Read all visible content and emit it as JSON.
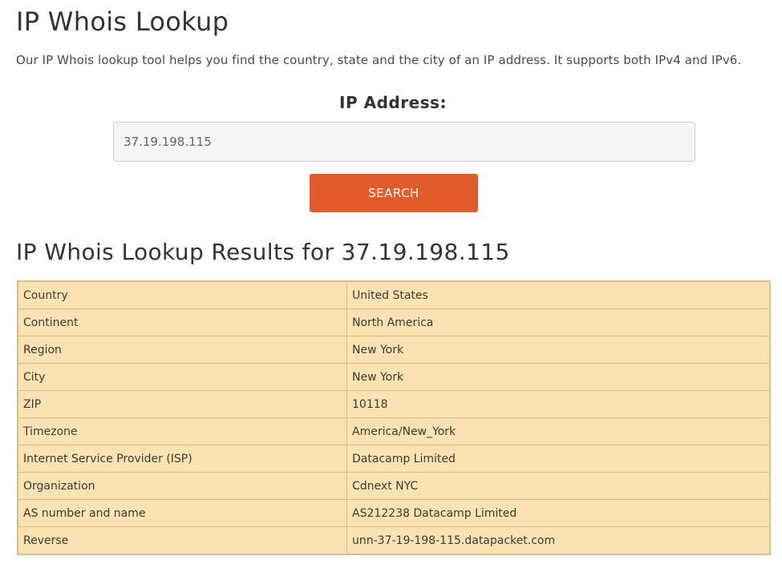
{
  "header": {
    "title": "IP Whois Lookup",
    "intro": "Our IP Whois lookup tool helps you find the country, state and the city of an IP address. It supports both IPv4 and IPv6."
  },
  "form": {
    "label": "IP Address:",
    "input_value": "37.19.198.115",
    "search_label": "SEARCH"
  },
  "results": {
    "title": "IP Whois Lookup Results for 37.19.198.115",
    "rows": [
      {
        "key": "Country",
        "value": "United States"
      },
      {
        "key": "Continent",
        "value": "North America"
      },
      {
        "key": "Region",
        "value": "New York"
      },
      {
        "key": "City",
        "value": "New York"
      },
      {
        "key": "ZIP",
        "value": "10118"
      },
      {
        "key": "Timezone",
        "value": "America/New_York"
      },
      {
        "key": "Internet Service Provider (ISP)",
        "value": "Datacamp Limited"
      },
      {
        "key": "Organization",
        "value": "Cdnext NYC"
      },
      {
        "key": "AS number and name",
        "value": "AS212238 Datacamp Limited"
      },
      {
        "key": "Reverse",
        "value": "unn-37-19-198-115.datapacket.com"
      }
    ]
  },
  "colors": {
    "accent": "#e25b2b",
    "table_bg": "#fbe3b1",
    "table_border": "#d8c08e"
  }
}
